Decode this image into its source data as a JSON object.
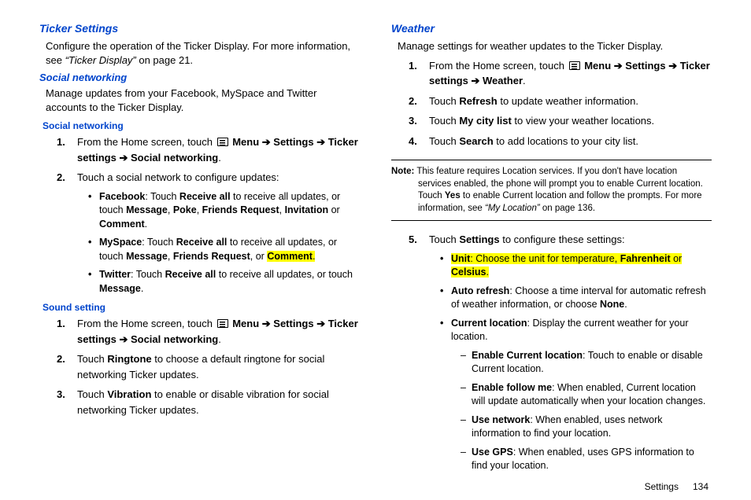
{
  "left": {
    "h_ticker": "Ticker Settings",
    "ticker_p_a": "Configure the operation of the Ticker Display. For more information, see ",
    "ticker_p_ref": "“Ticker Display”",
    "ticker_p_b": " on page 21.",
    "h_social": "Social networking",
    "social_p": "Manage updates from your Facebook, MySpace and Twitter accounts to the Ticker Display.",
    "h_social_sub": "Social networking",
    "sn_step1_a": "From the Home screen, touch ",
    "sn_step1_b": "Menu",
    "sn_step1_c": "Settings",
    "sn_step1_d": "Ticker settings",
    "sn_step1_e": "Social networking",
    "sn_step2": "Touch a social network to configure updates:",
    "fb_name": "Facebook",
    "fb_a": ": Touch ",
    "fb_recv": "Receive all",
    "fb_b": " to receive all updates, or touch ",
    "fb_msg": "Message",
    "fb_poke": "Poke",
    "fb_fr": "Friends Request",
    "fb_inv": "Invitation",
    "fb_or": " or ",
    "fb_cmt": "Comment",
    "ms_name": "MySpace",
    "ms_cmt": "Comment",
    "tw_name": "Twitter",
    "h_sound": "Sound setting",
    "ss_step2_a": "Touch ",
    "ss_step2_b": "Ringtone",
    "ss_step2_c": " to choose a default ringtone for social networking Ticker updates.",
    "ss_step3_a": "Touch ",
    "ss_step3_b": "Vibration",
    "ss_step3_c": " to enable or disable vibration for social networking Ticker updates."
  },
  "right": {
    "h_weather": "Weather",
    "weather_p": "Manage settings for weather updates to the Ticker Display.",
    "w1_a": "From the Home screen, touch ",
    "w1_menu": "Menu",
    "w1_set": "Settings",
    "w1_tick": "Ticker settings",
    "w1_weat": "Weather",
    "w2_a": "Touch ",
    "w2_b": "Refresh",
    "w2_c": " to update weather information.",
    "w3_a": "Touch ",
    "w3_b": "My city list",
    "w3_c": " to view your weather locations.",
    "w4_a": "Touch ",
    "w4_b": "Search",
    "w4_c": " to add locations to your city list.",
    "note_label": "Note:",
    "note_a": " This feature requires Location services. If you don't have location services enabled, the phone will prompt you to enable Current location. Touch ",
    "note_yes": "Yes",
    "note_b": " to enable Current location and follow the prompts. For more information, see ",
    "note_ref": "“My Location”",
    "note_c": " on page 136.",
    "w5_a": "Touch ",
    "w5_b": "Settings",
    "w5_c": " to configure these settings:",
    "unit_name": "Unit",
    "unit_a": ": Choose the unit for temperature, ",
    "unit_f": "Fahrenheit",
    "unit_or": " or ",
    "unit_c": "Celsius",
    "ar_name": "Auto refresh",
    "ar_a": ": Choose a time interval for automatic refresh of weather information, or choose ",
    "ar_none": "None",
    "cl_name": "Current location",
    "cl_a": ": Display the current weather for your location.",
    "d1_b": "Enable Current location",
    "d1_a": ": Touch to enable or disable Current location.",
    "d2_b": "Enable follow me",
    "d2_a": ": When enabled, Current location will update automatically when your location changes.",
    "d3_b": "Use network",
    "d3_a": ": When enabled, uses network information to find your location.",
    "d4_b": "Use GPS",
    "d4_a": ": When enabled, uses GPS information to find your location."
  },
  "footer": {
    "section": "Settings",
    "page": "134"
  },
  "sep": {
    "comma": ", ",
    "period": ".",
    "arrow": " ➔ ",
    "or": ", or "
  }
}
